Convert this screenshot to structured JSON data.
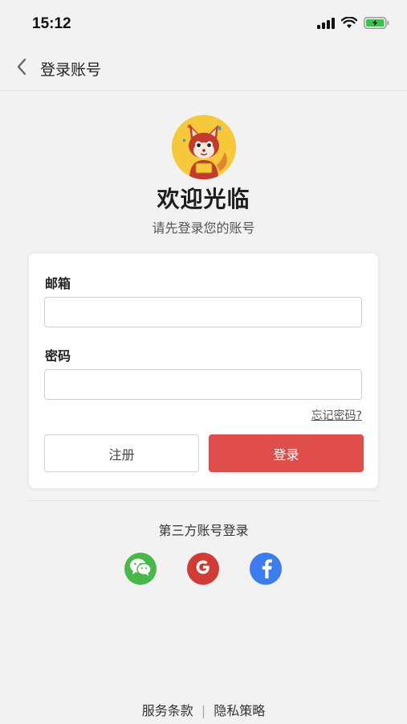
{
  "status_bar": {
    "time": "15:12"
  },
  "nav": {
    "title": "登录账号",
    "back_icon": "chevron-left-icon"
  },
  "header": {
    "avatar_icon": "squirrel-mascot-icon",
    "welcome": "欢迎光临",
    "subtitle": "请先登录您的账号"
  },
  "form": {
    "email_label": "邮箱",
    "email_value": "",
    "password_label": "密码",
    "password_value": "",
    "forgot_link": "忘记密码?",
    "register_button": "注册",
    "login_button": "登录"
  },
  "third_party": {
    "title": "第三方账号登录",
    "providers": [
      "wechat-icon",
      "google-icon",
      "facebook-icon"
    ]
  },
  "footer": {
    "terms": "服务条款",
    "separator": "|",
    "privacy": "隐私策略"
  },
  "colors": {
    "primary": "#e04e4c",
    "wechat": "#48b84b",
    "google": "#d03b35",
    "facebook": "#3b7cef",
    "background": "#f2f2f2"
  }
}
